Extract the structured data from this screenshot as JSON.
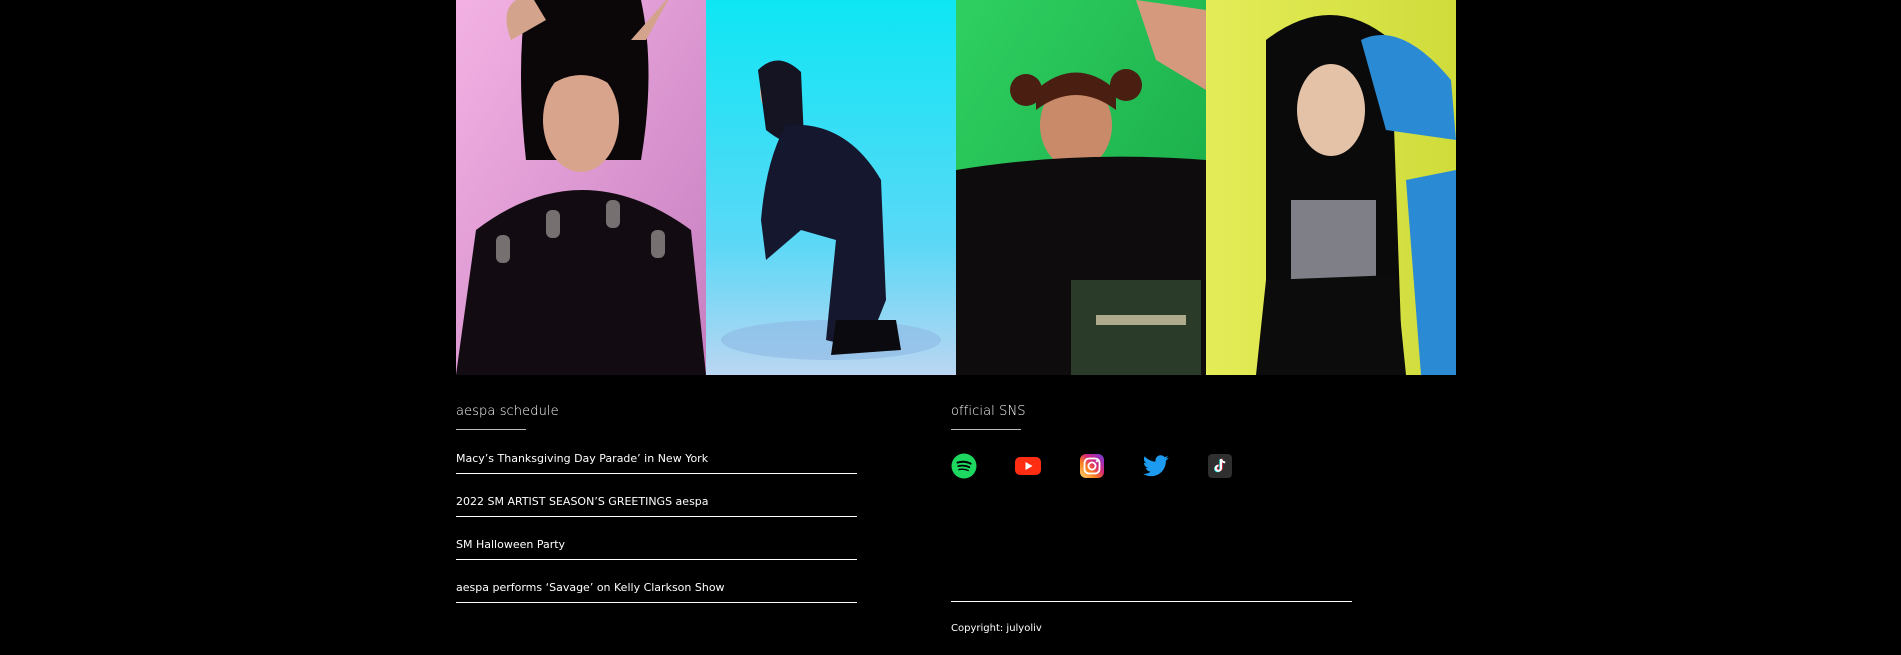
{
  "photos": [
    {
      "name": "member-1",
      "bg": "#e99bd6"
    },
    {
      "name": "member-2",
      "bg": "#15e6f3"
    },
    {
      "name": "member-3",
      "bg": "#22c356"
    },
    {
      "name": "member-4",
      "bg": "#e7e94a"
    }
  ],
  "schedule": {
    "title": "aespa schedule",
    "items": [
      {
        "label": "Macy’s Thanksgiving Day Parade’ in New York"
      },
      {
        "label": "2022 SM ARTIST SEASON’S GREETINGS aespa"
      },
      {
        "label": "SM Halloween Party"
      },
      {
        "label": "aespa performs ‘Savage’ on Kelly Clarkson Show"
      }
    ]
  },
  "sns": {
    "title": "official SNS",
    "icons": [
      {
        "name": "spotify-icon",
        "color": "#1ed760"
      },
      {
        "name": "youtube-icon",
        "color": "#ff2e12"
      },
      {
        "name": "instagram-icon",
        "color": "#d62976"
      },
      {
        "name": "twitter-icon",
        "color": "#1d9bf0"
      },
      {
        "name": "tiktok-icon",
        "color": "#333333"
      }
    ]
  },
  "footer": {
    "copyright": "Copyright: julyoliv"
  }
}
